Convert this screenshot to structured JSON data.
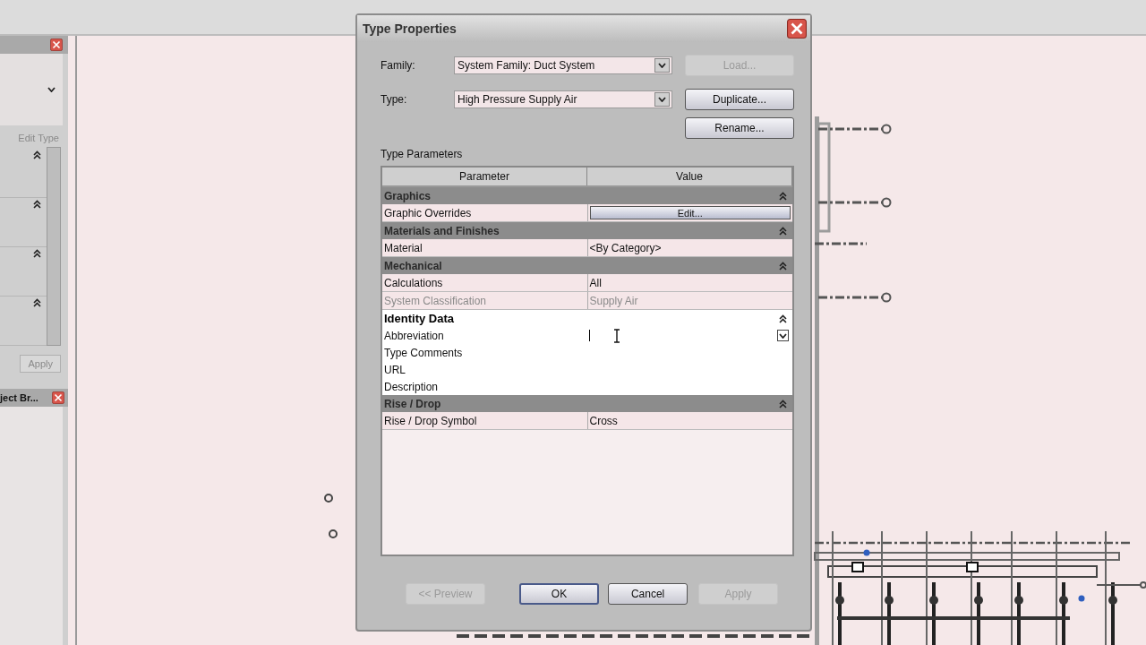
{
  "properties_panel": {
    "edit_type": "Edit Type",
    "apply": "Apply"
  },
  "project_browser": {
    "title": "ject Br..."
  },
  "window": {
    "title": "Type Properties"
  },
  "family": {
    "label": "Family:",
    "value": "System Family: Duct System"
  },
  "type": {
    "label": "Type:",
    "value": "High Pressure Supply Air"
  },
  "side_buttons": [
    {
      "label": "Load...",
      "disabled": true
    },
    {
      "label": "Duplicate...",
      "disabled": false
    },
    {
      "label": "Rename...",
      "disabled": false
    }
  ],
  "type_parameters": {
    "title": "Type Parameters",
    "columns": [
      "Parameter",
      "Value"
    ],
    "groups": [
      {
        "name": "Graphics",
        "highlighted": false,
        "rows": [
          {
            "parameter": "Graphic Overrides",
            "value": "Edit...",
            "kind": "button",
            "disabled": false
          }
        ]
      },
      {
        "name": "Materials and Finishes",
        "highlighted": false,
        "rows": [
          {
            "parameter": "Material",
            "value": "<By Category>",
            "kind": "text",
            "disabled": false
          }
        ]
      },
      {
        "name": "Mechanical",
        "highlighted": false,
        "rows": [
          {
            "parameter": "Calculations",
            "value": "All",
            "kind": "text",
            "disabled": false
          },
          {
            "parameter": "System Classification",
            "value": "Supply Air",
            "kind": "text",
            "disabled": true
          }
        ]
      },
      {
        "name": "Identity Data",
        "highlighted": true,
        "rows": [
          {
            "parameter": "Abbreviation",
            "kind": "dropdown",
            "disabled": false
          },
          {
            "parameter": "Type Comments",
            "kind": "text",
            "disabled": false
          },
          {
            "parameter": "URL",
            "kind": "text",
            "disabled": false
          },
          {
            "parameter": "Description",
            "kind": "text",
            "disabled": false
          }
        ]
      },
      {
        "name": "Rise / Drop",
        "highlighted": false,
        "rows": [
          {
            "parameter": "Rise / Drop Symbol",
            "value": "Cross",
            "kind": "text",
            "disabled": false
          }
        ]
      }
    ]
  },
  "bottom_buttons": [
    {
      "label": "<< Preview",
      "disabled": true,
      "default": false
    },
    {
      "label": "OK",
      "disabled": false,
      "default": true
    },
    {
      "label": "Cancel",
      "disabled": false,
      "default": false
    },
    {
      "label": "Apply",
      "disabled": true,
      "default": false
    }
  ]
}
